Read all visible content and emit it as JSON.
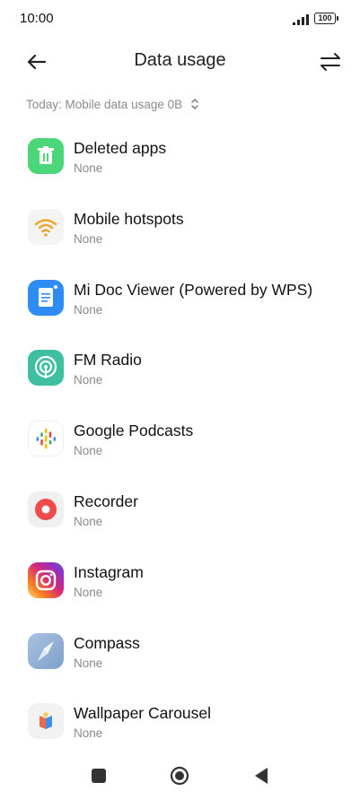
{
  "status_bar": {
    "time": "10:00",
    "battery": "100"
  },
  "header": {
    "title": "Data usage"
  },
  "subtitle": "Today: Mobile data usage 0B",
  "apps": [
    {
      "name": "Deleted apps",
      "usage": "None",
      "icon": "trash-icon",
      "color": "#4cd67a"
    },
    {
      "name": "Mobile hotspots",
      "usage": "None",
      "icon": "wifi-hotspot-icon",
      "color": "#f2a42a"
    },
    {
      "name": "Mi Doc Viewer (Powered by WPS)",
      "usage": "None",
      "icon": "document-icon",
      "color": "#2f8cf5"
    },
    {
      "name": "FM Radio",
      "usage": "None",
      "icon": "radio-icon",
      "color": "#3ec0a0"
    },
    {
      "name": "Google Podcasts",
      "usage": "None",
      "icon": "podcasts-icon",
      "color": "#4285f4"
    },
    {
      "name": "Recorder",
      "usage": "None",
      "icon": "record-icon",
      "color": "#f04a4a"
    },
    {
      "name": "Instagram",
      "usage": "None",
      "icon": "instagram-icon",
      "color": "#d6249f"
    },
    {
      "name": "Compass",
      "usage": "None",
      "icon": "compass-icon",
      "color": "#8fb0d8"
    },
    {
      "name": "Wallpaper Carousel",
      "usage": "None",
      "icon": "wallpaper-icon",
      "color": "#f06a4a"
    }
  ]
}
